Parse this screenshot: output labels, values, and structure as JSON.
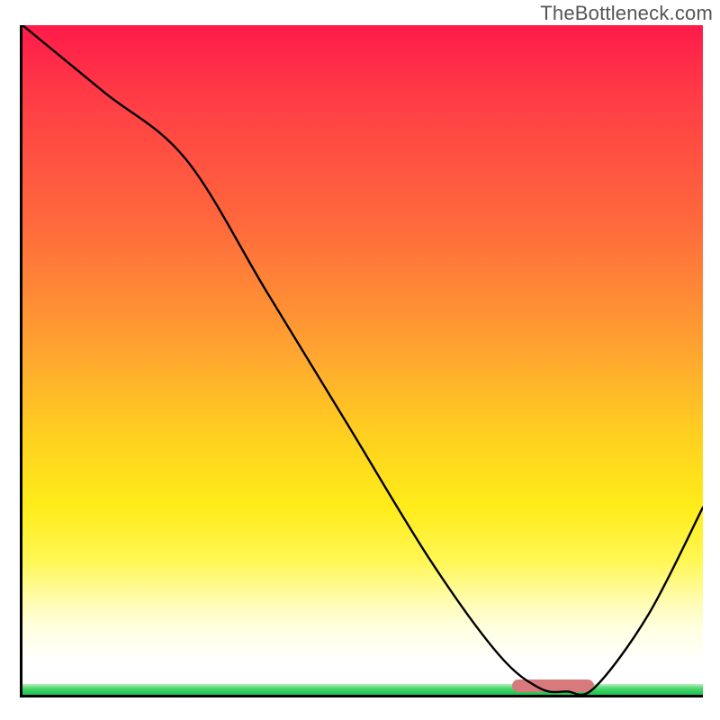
{
  "watermark": "TheBottleneck.com",
  "colors": {
    "gradient_top": "#ff1a4a",
    "gradient_mid": "#ffd21f",
    "gradient_low": "#ffffff",
    "green_band": "#17c24b",
    "curve": "#000000",
    "optimal_marker": "#d87a7c",
    "axes": "#000000"
  },
  "chart_data": {
    "type": "line",
    "title": "",
    "xlabel": "",
    "ylabel": "",
    "xlim": [
      0,
      100
    ],
    "ylim": [
      0,
      100
    ],
    "grid": false,
    "legend": false,
    "optimal_range_x": [
      72,
      84
    ],
    "series": [
      {
        "name": "bottleneck-curve",
        "x": [
          0,
          12,
          24,
          36,
          48,
          60,
          70,
          76,
          80,
          84,
          92,
          100
        ],
        "y": [
          100,
          90,
          80,
          60,
          40,
          20,
          6,
          1,
          0.5,
          1,
          12,
          28
        ]
      }
    ],
    "annotations": []
  }
}
